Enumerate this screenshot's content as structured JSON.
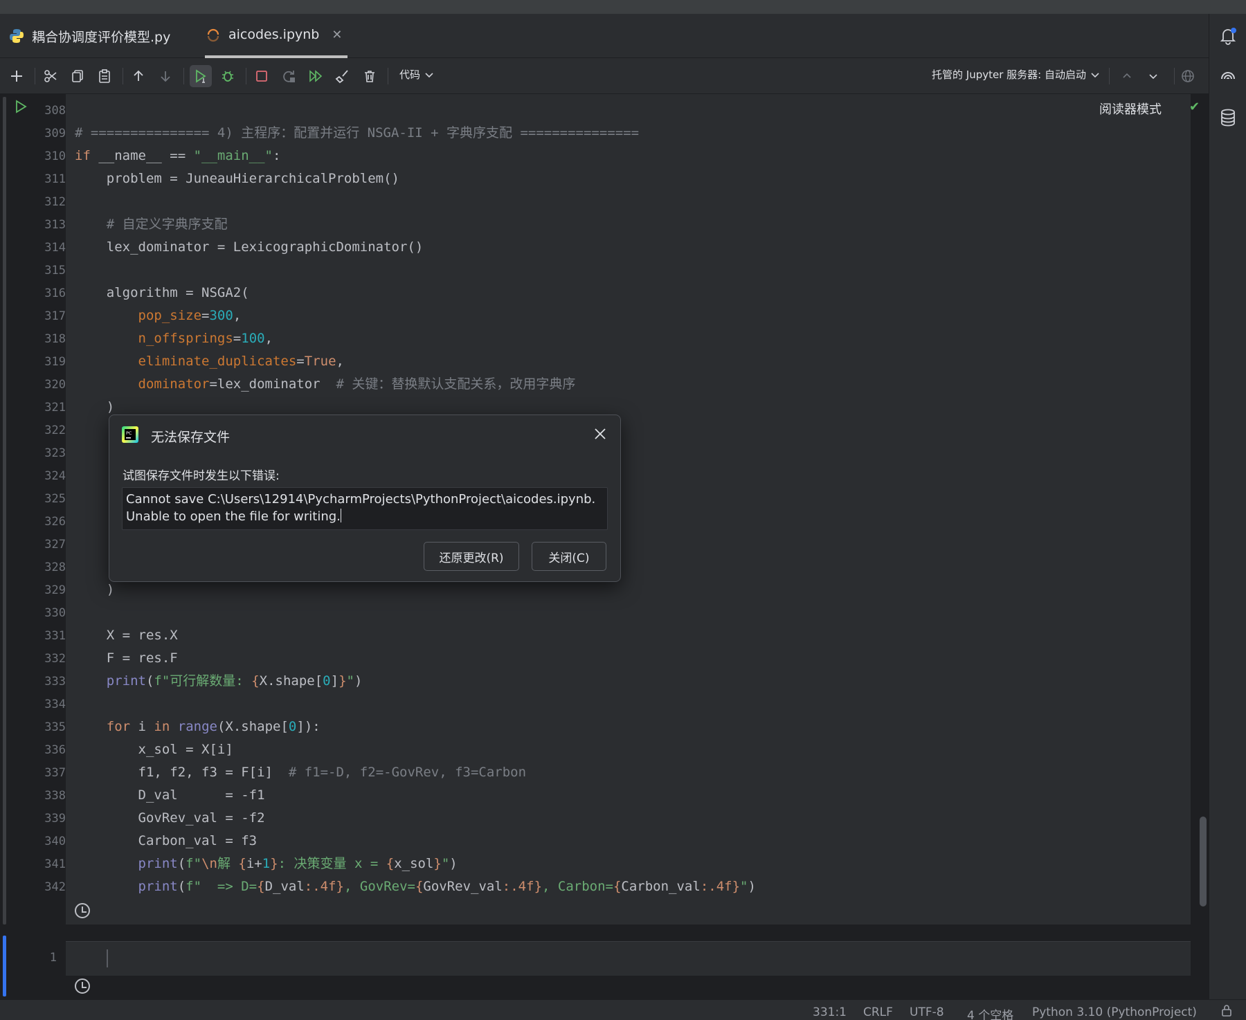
{
  "tabs": [
    {
      "label": "耦合协调度评价模型.py",
      "icon": "python-file-icon",
      "active": false
    },
    {
      "label": "aicodes.ipynb",
      "icon": "notebook-loading-icon",
      "active": true
    }
  ],
  "toolbar": {
    "cell_type": "代码",
    "jupyter_server": "托管的 Jupyter 服务器: 自动启动"
  },
  "editor": {
    "reader_mode": "阅读器模式",
    "line_numbers": [
      "308",
      "309",
      "310",
      "311",
      "312",
      "313",
      "314",
      "315",
      "316",
      "317",
      "318",
      "319",
      "320",
      "321",
      "322",
      "323",
      "324",
      "325",
      "326",
      "327",
      "328",
      "329",
      "330",
      "331",
      "332",
      "333",
      "334",
      "335",
      "336",
      "337",
      "338",
      "339",
      "340",
      "341",
      "342"
    ],
    "code": {
      "l309": "# =============== 4) 主程序：配置并运行 NSGA-II + 字典序支配 ===============",
      "l310_kw": "if",
      "l310_a": " __name__ == ",
      "l310_s": "\"__main__\"",
      "l310_b": ":",
      "l311": "    problem = JuneauHierarchicalProblem()",
      "l313": "    # 自定义字典序支配",
      "l314": "    lex_dominator = LexicographicDominator()",
      "l316": "    algorithm = NSGA2(",
      "l317_k": "pop_size",
      "l317_v": "300",
      "l318_k": "n_offsprings",
      "l318_v": "100",
      "l319_k": "eliminate_duplicates",
      "l319_v": "True",
      "l320_k": "dominator",
      "l320_v": "=lex_dominator  ",
      "l320_c": "# 关键：替换默认支配关系，改用字典序",
      "l321": "    )",
      "l329": "    )",
      "l331": "    X = res.X",
      "l332": "    F = res.F",
      "l333_f": "print",
      "l333_s1": "f\"可行解数量: ",
      "l333_m": "X.shape[",
      "l333_n": "0",
      "l333_e": "]",
      "l335_kw1": "for",
      "l335_a": " i ",
      "l335_kw2": "in",
      "l335_r": "range",
      "l335_b": "(X.shape[",
      "l335_n": "0",
      "l335_c": "]):",
      "l336": "        x_sol = X[i]",
      "l337_a": "        f1, f2, f3 = F[i]  ",
      "l337_c": "# f1=-D, f2=-GovRev, f3=Carbon",
      "l338": "        D_val      = -f1",
      "l339": "        GovRev_val = -f2",
      "l340": "        Carbon_val = f3",
      "l341_p": "print",
      "l341_s1": "f\"",
      "l341_esc": "\\n",
      "l341_s2": "解 ",
      "l341_i": "i+",
      "l341_n": "1",
      "l341_s3": ": 决策变量 x = ",
      "l341_x": "x_sol",
      "l342_p": "print",
      "l342_s1": "f\"  => D=",
      "l342_v1": "D_val",
      "l342_f1": ":.4f",
      "l342_s2": ", GovRev=",
      "l342_v2": "GovRev_val",
      "l342_f2": ":.4f",
      "l342_s3": ", Carbon=",
      "l342_v3": "Carbon_val",
      "l342_f3": ":.4f"
    },
    "next_cell_line": "1"
  },
  "dialog": {
    "title": "无法保存文件",
    "message": "试图保存文件时发生以下错误:",
    "error_line1": "Cannot save C:\\Users\\12914\\PycharmProjects\\PythonProject\\aicodes.ipynb.",
    "error_line2": "Unable to open the file for writing.",
    "revert_label": "还原更改(R)",
    "close_label": "关闭(C)"
  },
  "status": {
    "position": "331:1",
    "line_sep": "CRLF",
    "encoding": "UTF-8",
    "indent": "4 个空格",
    "interpreter": "Python 3.10 (PythonProject)"
  },
  "colors": {
    "keyword": "#cf8e6d",
    "string": "#6aab73",
    "number": "#2aacb8",
    "comment": "#7a7e85",
    "run_green": "#5fb865",
    "stop_red": "#e06c75",
    "accent_blue": "#3574f0"
  }
}
